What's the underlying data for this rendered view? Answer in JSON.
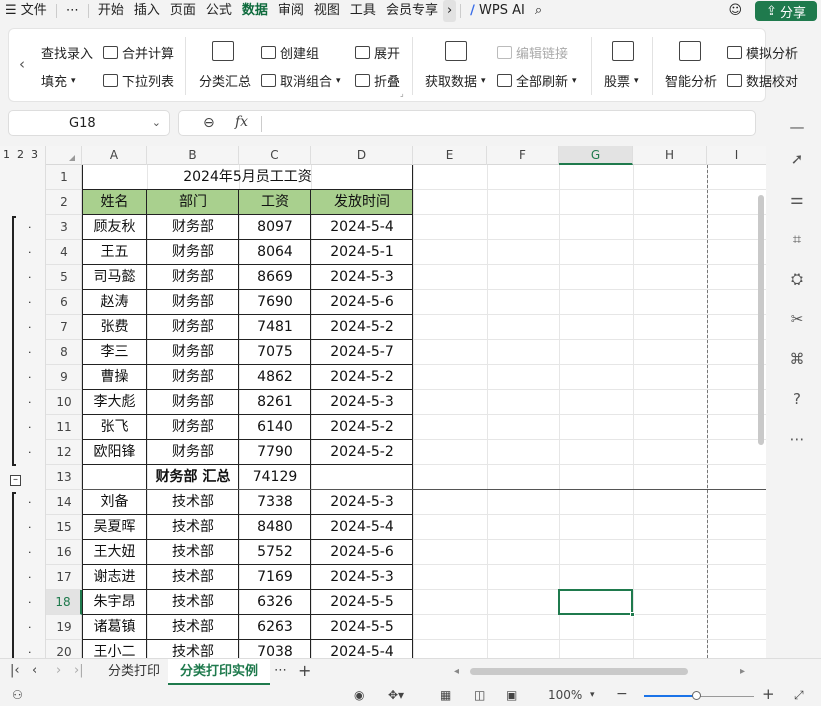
{
  "menubar": {
    "file": "文件",
    "more": "⋯",
    "tabs": [
      "开始",
      "插入",
      "页面",
      "公式",
      "数据",
      "审阅",
      "视图",
      "工具",
      "会员专享"
    ],
    "active_tab": "数据",
    "ai": "WPS AI",
    "share": "分享"
  },
  "ribbon": {
    "find_entry": "查找录入",
    "fill": "填充",
    "merge_calc": "合并计算",
    "dropdown_list": "下拉列表",
    "subtotal": "分类汇总",
    "create_group": "创建组",
    "ungroup": "取消组合",
    "expand": "展开",
    "collapse": "折叠",
    "get_data": "获取数据",
    "edit_links": "编辑链接",
    "refresh_all": "全部刷新",
    "stocks": "股票",
    "smart_analysis": "智能分析",
    "what_if": "模拟分析",
    "data_check": "数据校对"
  },
  "formula_bar": {
    "name_box": "G18",
    "fx": "fx",
    "content": ""
  },
  "outline_levels": [
    "1",
    "2",
    "3"
  ],
  "columns": [
    "A",
    "B",
    "C",
    "D",
    "E",
    "F",
    "G",
    "H",
    "I"
  ],
  "selected_column": "G",
  "rows": [
    "1",
    "2",
    "3",
    "4",
    "5",
    "6",
    "7",
    "8",
    "9",
    "10",
    "11",
    "12",
    "13",
    "14",
    "15",
    "16",
    "17",
    "18",
    "19",
    "20"
  ],
  "selected_row": "18",
  "sheet": {
    "title": "2024年5月员工工资",
    "headers": [
      "姓名",
      "部门",
      "工资",
      "发放时间"
    ],
    "data": [
      [
        "顾友秋",
        "财务部",
        "8097",
        "2024-5-4"
      ],
      [
        "王五",
        "财务部",
        "8064",
        "2024-5-1"
      ],
      [
        "司马懿",
        "财务部",
        "8669",
        "2024-5-3"
      ],
      [
        "赵涛",
        "财务部",
        "7690",
        "2024-5-6"
      ],
      [
        "张费",
        "财务部",
        "7481",
        "2024-5-2"
      ],
      [
        "李三",
        "财务部",
        "7075",
        "2024-5-7"
      ],
      [
        "曹操",
        "财务部",
        "4862",
        "2024-5-2"
      ],
      [
        "李大彪",
        "财务部",
        "8261",
        "2024-5-3"
      ],
      [
        "张飞",
        "财务部",
        "6140",
        "2024-5-2"
      ],
      [
        "欧阳锋",
        "财务部",
        "7790",
        "2024-5-2"
      ],
      [
        "",
        "财务部 汇总",
        "74129",
        ""
      ],
      [
        "刘备",
        "技术部",
        "7338",
        "2024-5-3"
      ],
      [
        "吴夏晖",
        "技术部",
        "8480",
        "2024-5-4"
      ],
      [
        "王大妞",
        "技术部",
        "5752",
        "2024-5-6"
      ],
      [
        "谢志进",
        "技术部",
        "7169",
        "2024-5-3"
      ],
      [
        "朱宇昂",
        "技术部",
        "6326",
        "2024-5-5"
      ],
      [
        "诸葛镇",
        "技术部",
        "6263",
        "2024-5-5"
      ],
      [
        "王小二",
        "技术部",
        "7038",
        "2024-5-4"
      ]
    ]
  },
  "sheet_tabs": [
    "分类打印",
    "分类打印实例"
  ],
  "active_sheet": "分类打印实例",
  "status": {
    "zoom": "100%",
    "zoom_level_percent": 48
  },
  "colors": {
    "accent": "#1f7a4d",
    "header_fill": "#a9d08e"
  }
}
